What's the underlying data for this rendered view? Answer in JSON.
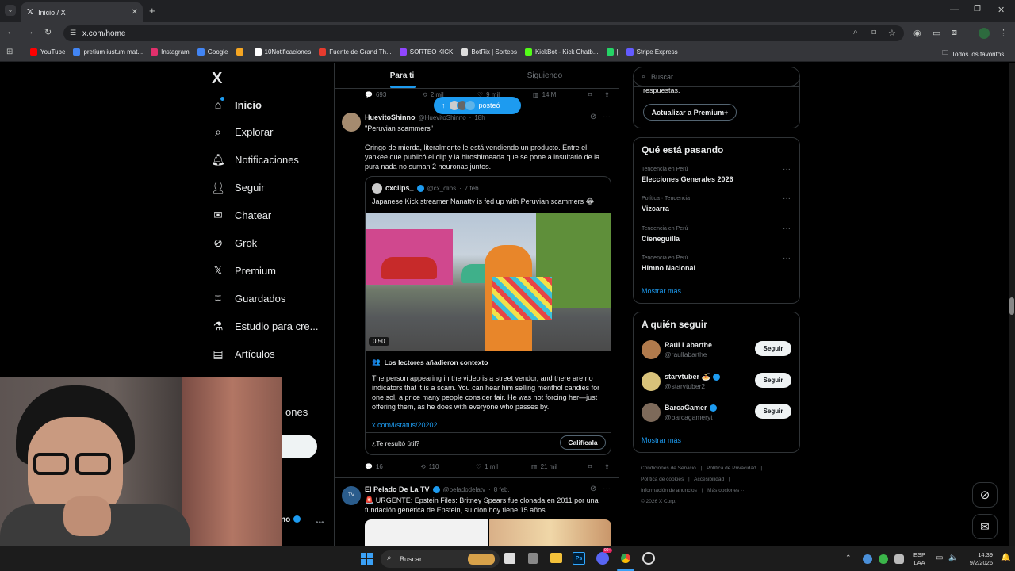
{
  "browser": {
    "tab_title": "Inicio / X",
    "new_tab_icon": "+",
    "url": "x.com/home",
    "bookmarks": [
      {
        "label": "YouTube",
        "color": "#ff0000"
      },
      {
        "label": "pretium iustum mat...",
        "color": "#4285f4"
      },
      {
        "label": "Instagram",
        "color": "#e1306c"
      },
      {
        "label": "Google",
        "color": "#4285f4"
      },
      {
        "label": "",
        "color": "#f5a623"
      },
      {
        "label": "10Notificaciones",
        "color": "#ffffff"
      },
      {
        "label": "Fuente de Grand Th...",
        "color": "#e63b2e"
      },
      {
        "label": "SORTEO KICK",
        "color": "#9146ff"
      },
      {
        "label": "BotRix | Sorteos",
        "color": "#dddddd"
      },
      {
        "label": "KickBot - Kick Chatb...",
        "color": "#53fc18"
      },
      {
        "label": "|",
        "color": "#25d366"
      },
      {
        "label": "Stripe Express",
        "color": "#635bff"
      }
    ],
    "all_favorites": "Todos los favoritos"
  },
  "sidebar": {
    "logo": "X",
    "items": [
      {
        "label": "Inicio",
        "icon": "home-icon"
      },
      {
        "label": "Explorar",
        "icon": "search-icon"
      },
      {
        "label": "Notificaciones",
        "icon": "bell-icon"
      },
      {
        "label": "Seguir",
        "icon": "person-add-icon"
      },
      {
        "label": "Chatear",
        "icon": "mail-icon"
      },
      {
        "label": "Grok",
        "icon": "grok-icon"
      },
      {
        "label": "Premium",
        "icon": "x-icon"
      },
      {
        "label": "Guardados",
        "icon": "bookmark-icon"
      },
      {
        "label": "Estudio para cre...",
        "icon": "flask-icon"
      },
      {
        "label": "Artículos",
        "icon": "article-icon"
      }
    ],
    "partial_more": "ones",
    "profile_partial": "no"
  },
  "feed": {
    "tabs": [
      "Para ti",
      "Siguiendo"
    ],
    "posted_pill": "posteó",
    "prev_stats": {
      "replies": "693",
      "reposts": "2 mil",
      "likes": "9 mil",
      "views": "14 M"
    },
    "post1": {
      "name": "HuevitoShinno",
      "handle": "@HuevitoShinno",
      "time": "18h",
      "quote_line": "\"Peruvian scammers\"",
      "text": "Gringo de mierda, literalmente le está vendiendo un producto. Entre el yankee que publicó el clip y la hiroshimeada que se pone a insultarlo de la pura nada no suman 2 neuronas juntos.",
      "quoted": {
        "name": "cxclips_",
        "handle": "@cx_clips",
        "date": "7 feb.",
        "text": "Japanese Kick streamer Nanatty is fed up with Peruvian scammers 😂",
        "video_time": "0:50"
      },
      "context": {
        "title": "Los lectores añadieron contexto",
        "text": "The person appearing in the video is a street vendor, and there are no indicators that it is a scam. You can hear him selling menthol candies for one sol, a price many people consider fair. He was not forcing her—just offering them, as he does with everyone who passes by.",
        "link": "x.com/i/status/20202...",
        "question": "¿Te resultó útil?",
        "rate": "Califícala"
      },
      "stats": {
        "replies": "16",
        "reposts": "110",
        "likes": "1 mil",
        "views": "21 mil"
      }
    },
    "post2": {
      "name": "El Pelado De La TV",
      "handle": "@peladodelatv",
      "date": "8 feb.",
      "text": "🚨 URGENTE: Epstein Files: Britney Spears fue clonada en 2011 por una fundación genética de Epstein, su clon hoy tiene 15 años."
    }
  },
  "right": {
    "search_placeholder": "Buscar",
    "premium_tail": "respuestas.",
    "premium_btn": "Actualizar a Premium+",
    "trends_title": "Qué está pasando",
    "trends": [
      {
        "context": "Tendencia en Perú",
        "name": "Elecciones Generales 2026"
      },
      {
        "context": "Política · Tendencia",
        "name": "Vizcarra"
      },
      {
        "context": "Tendencia en Perú",
        "name": "Cieneguilla"
      },
      {
        "context": "Tendencia en Perú",
        "name": "Himno Nacional"
      }
    ],
    "show_more": "Mostrar más",
    "follow_title": "A quién seguir",
    "follow": [
      {
        "name": "Raúl Labarthe",
        "handle": "@raullabarthe",
        "color": "#b07a4c"
      },
      {
        "name": "starvtuber 🍝",
        "handle": "@starvtuber2",
        "color": "#d8c27a"
      },
      {
        "name": "BarcaGamer",
        "handle": "@barcagameryt",
        "color": "#7d6a5a"
      }
    ],
    "follow_btn": "Seguir",
    "footer": [
      "Condiciones de Servicio",
      "Política de Privacidad",
      "Política de cookies",
      "Accesibilidad",
      "Información de anuncios",
      "Más opciones ···",
      "© 2026 X Corp."
    ]
  },
  "taskbar": {
    "search": "Buscar",
    "lang1": "ESP",
    "lang2": "LAA",
    "time": "14:39",
    "date": "9/2/2026",
    "badge": "99+"
  }
}
